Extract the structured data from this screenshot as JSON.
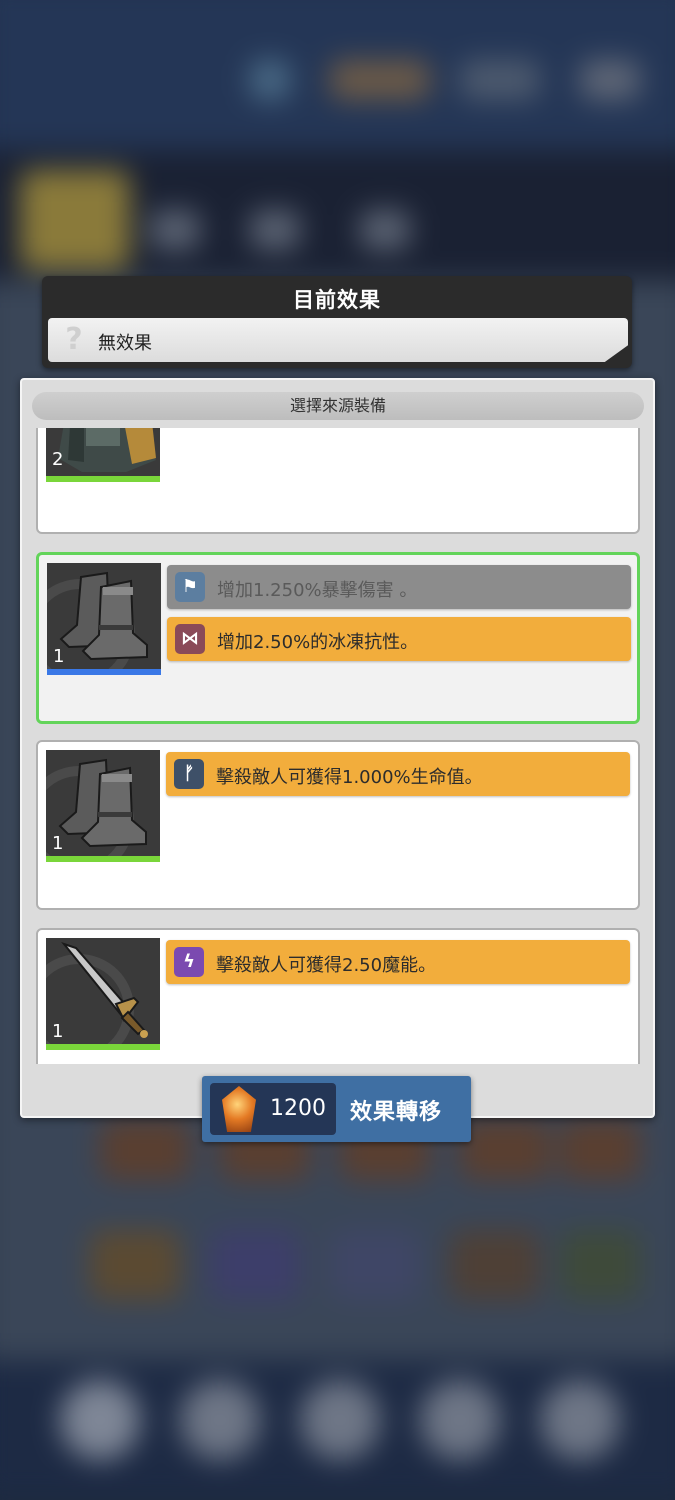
{
  "current_effect": {
    "title": "目前效果",
    "value": "無效果",
    "icon": "question-mark-icon"
  },
  "source_panel": {
    "header": "選擇來源裝備",
    "items": [
      {
        "kind": "armor",
        "quantity": "2",
        "effects": []
      },
      {
        "kind": "boots",
        "quantity": "1",
        "selected": true,
        "effects": [
          {
            "text": "增加1.250%暴擊傷害 。",
            "style": "grey",
            "icon": "flag-rune-icon"
          },
          {
            "text": "增加2.50%的冰凍抗性。",
            "style": "orange",
            "icon": "bowtie-rune-icon"
          }
        ]
      },
      {
        "kind": "boots",
        "quantity": "1",
        "effects": [
          {
            "text": "擊殺敵人可獲得1.000%生命值。",
            "style": "orange",
            "icon": "fehu-rune-icon"
          }
        ]
      },
      {
        "kind": "sword",
        "quantity": "1",
        "effects": [
          {
            "text": "擊殺敵人可獲得2.50魔能。",
            "style": "orange",
            "icon": "zigzag-rune-icon"
          }
        ]
      }
    ]
  },
  "transfer": {
    "cost": "1200",
    "label": "效果轉移",
    "currency_icon": "crystal-gem-icon"
  },
  "colors": {
    "orange_effect": "#f2ad3c",
    "grey_effect": "#8c8c8c",
    "selected_border": "#63d45a",
    "button_blue": "#3f6fa3"
  }
}
